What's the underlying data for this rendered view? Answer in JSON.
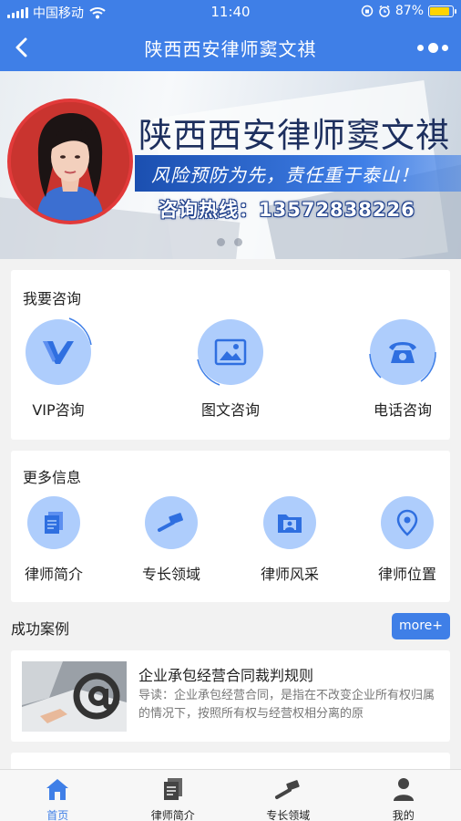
{
  "status_bar": {
    "carrier": "中国移动",
    "time": "11:40",
    "battery": "87%",
    "battery_level": 0.87
  },
  "nav": {
    "title": "陕西西安律师窦文祺",
    "back_icon": "back-chevron-icon",
    "more_icon": "more-dots-icon"
  },
  "banner": {
    "headline": "陕西西安律师窦文祺",
    "slogan": "风险预防为先，责任重于泰山！",
    "hotline": "咨询热线：13572838226",
    "slides": 2,
    "active_slide": 1
  },
  "consult": {
    "title": "我要咨询",
    "items": [
      {
        "label": "VIP咨询",
        "icon": "vip-icon"
      },
      {
        "label": "图文咨询",
        "icon": "image-text-icon"
      },
      {
        "label": "电话咨询",
        "icon": "telephone-icon"
      }
    ]
  },
  "more_info": {
    "title": "更多信息",
    "items": [
      {
        "label": "律师简介",
        "icon": "document-icon"
      },
      {
        "label": "专长领域",
        "icon": "gavel-icon"
      },
      {
        "label": "律师风采",
        "icon": "folder-photo-icon"
      },
      {
        "label": "律师位置",
        "icon": "location-pin-icon"
      }
    ]
  },
  "cases": {
    "title": "成功案例",
    "more_label": "more+",
    "items": [
      {
        "title": "企业承包经营合同裁判规则",
        "desc": "导读：企业承包经营合同，是指在不改变企业所有权归属的情况下，按照所有权与经营权相分离的原"
      }
    ]
  },
  "tabbar": {
    "items": [
      {
        "label": "首页",
        "icon": "home-icon",
        "active": true
      },
      {
        "label": "律师简介",
        "icon": "document-icon",
        "active": false
      },
      {
        "label": "专长领域",
        "icon": "gavel-icon",
        "active": false
      },
      {
        "label": "我的",
        "icon": "user-icon",
        "active": false
      }
    ]
  },
  "colors": {
    "primary": "#3f7fe7",
    "icon_bg": "#aecdfc",
    "icon_fg": "#2f6fe0",
    "active_tab": "#3f7fe7"
  }
}
